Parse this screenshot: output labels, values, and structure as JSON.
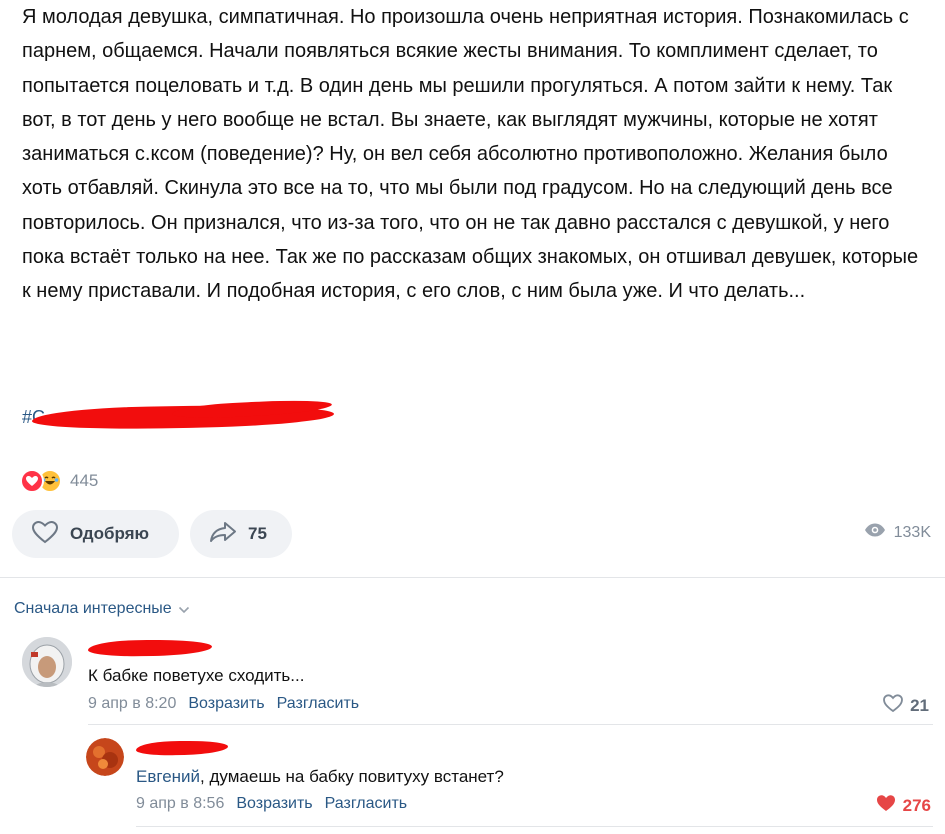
{
  "post": {
    "text": "Я молодая девушка, симпатичная. Но произошла очень неприятная история. Познакомилась с парнем, общаемся. Начали появляться всякие жесты внимания. То комплимент сделает, то попытается поцеловать и т.д. В один день мы решили прогуляться. А потом зайти к нему. Так вот, в тот день у него вообще не встал. Вы знаете, как выглядят мужчины, которые не хотят заниматься с.ксом (поведение)? Ну, он вел себя абсолютно противоположно. Желания было хоть отбавляй. Скинула это все на то, что мы были под градусом. Но на следующий день все повторилось. Он признался, что из-за того, что он не так давно расстался с девушкой, у него пока встаёт только на нее. Так же по рассказам общих знакомых, он отшивал девушек, которые к нему приставали. И подобная история, с его слов, с ним была уже. И что делать...",
    "hashtag_prefix": "#С",
    "reactions_count": "445",
    "like_label": "Одобряю",
    "share_count": "75",
    "views_count": "133K"
  },
  "comments": {
    "sort_label": "Сначала интересные",
    "items": [
      {
        "text": "К бабке поветухе сходить...",
        "date": "9 апр в 8:20",
        "reply_label": "Возразить",
        "disagree_label": "Разгласить",
        "likes": "21",
        "liked": false
      },
      {
        "mention": "Евгений",
        "text": ", думаешь на бабку повитуху встанет?",
        "date": "9 апр в 8:56",
        "reply_label": "Возразить",
        "disagree_label": "Разгласить",
        "likes": "276",
        "liked": true
      }
    ]
  },
  "colors": {
    "link": "#2a5885",
    "muted": "#818c99",
    "liked": "#e64646",
    "redaction": "#f20d0d",
    "pill_bg": "#f0f2f5"
  },
  "icons": [
    "heart-reaction-icon",
    "laugh-reaction-icon",
    "heart-outline-icon",
    "share-arrow-icon",
    "eye-icon",
    "chevron-down-icon",
    "heart-filled-icon"
  ]
}
